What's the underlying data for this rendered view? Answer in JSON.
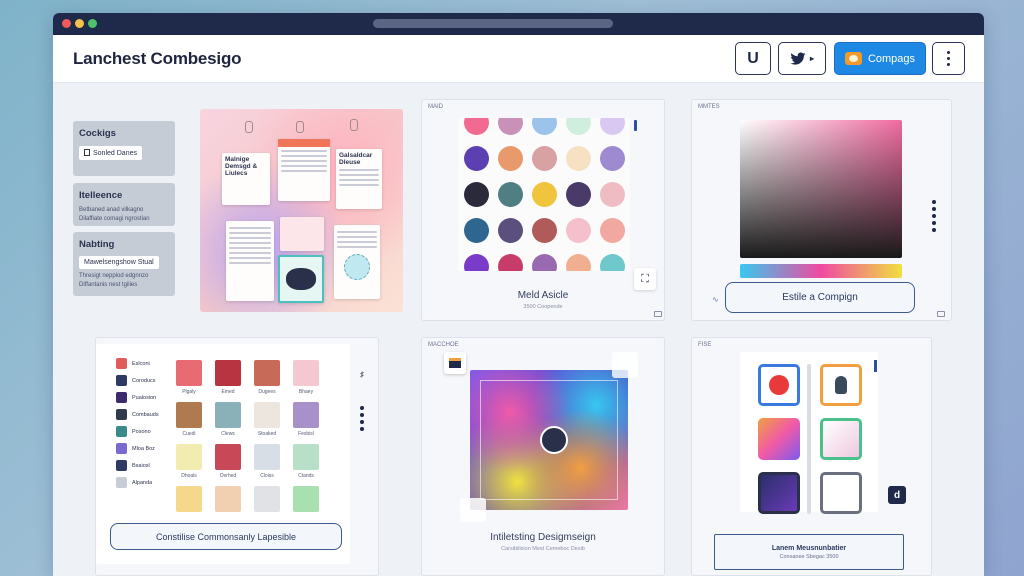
{
  "app": {
    "title": "Lanchest Combesigo"
  },
  "header": {
    "u_button": "U",
    "twitter_icon": "twitter-bird-icon",
    "campaign_button": "Compags",
    "menu_icon": "kebab-menu-icon"
  },
  "sidebar": [
    {
      "title": "Cockigs",
      "pill": "Sonled Danes"
    },
    {
      "title": "Itelleence",
      "lines": [
        "Betbaned anad vilkagno",
        "Dilaffiate comagi ngrostian"
      ]
    },
    {
      "title": "Nabting",
      "pill": "Mawelsengshow Stual",
      "lines": [
        "Thresigt neppiod edgnnzo",
        "Diffantanis nest tgilies"
      ]
    }
  ],
  "collage": {
    "notes": [
      "Malnige Demsgd & Liulecs",
      "Galsaldcar Dleuse"
    ]
  },
  "palette_panel": {
    "tag": "MAID",
    "caption": "Meld Asicle",
    "subcaption": "3500 Coopende",
    "colors": [
      [
        "#f06a92",
        "#c990b8",
        "#9cc4ea",
        "#cfeede",
        "#d8c8f2"
      ],
      [
        "#5c3fb0",
        "#e89a6c",
        "#d9a2a2",
        "#f6e2c2",
        "#9e8ad0"
      ],
      [
        "#2a2a3a",
        "#4f7f82",
        "#f0c43c",
        "#4a3a6a",
        "#f0bcc4"
      ],
      [
        "#2e6690",
        "#5b4f7e",
        "#b05a5a",
        "#f3c0cc",
        "#f0a8a0"
      ],
      [
        "#7a3cc8",
        "#c83c6a",
        "#9a6ab0",
        "#f0b090",
        "#6ec8cc"
      ]
    ]
  },
  "gradient_panel": {
    "tag": "MMTES",
    "button": "Estile a Compign"
  },
  "materials_panel": {
    "rows": [
      {
        "label": "Eslconi",
        "icon_color": "#e25b5b"
      },
      {
        "label": "Coroducs",
        "icon_color": "#2f3a64"
      },
      {
        "label": "Pualosion",
        "icon_color": "#3b2b6a"
      },
      {
        "label": "Combauds",
        "icon_color": "#2f3a4a"
      },
      {
        "label": "Posono",
        "icon_color": "#3a8a8a"
      },
      {
        "label": "Mloa Boz",
        "icon_color": "#7a6ad0"
      },
      {
        "label": "Bsaiosl",
        "icon_color": "#2f3a64"
      },
      {
        "label": "Alpanda",
        "icon_color": "#c8ccd6"
      }
    ],
    "tiles": [
      [
        {
          "c": "#e86a72",
          "l": "Plgaly"
        },
        {
          "c": "#b83440",
          "l": "Emed"
        },
        {
          "c": "#c86a58",
          "l": "Dugees"
        },
        {
          "c": "#f3c8d0",
          "l": "Bhaey"
        }
      ],
      [
        {
          "c": "#b07a50",
          "l": "Cuedi"
        },
        {
          "c": "#8ab0b8",
          "l": "Clews"
        },
        {
          "c": "#ece6de",
          "l": "Stoaked"
        },
        {
          "c": "#a890c8",
          "l": "Fesbisl"
        }
      ],
      [
        {
          "c": "#f3ecb0",
          "l": "Dhoals"
        },
        {
          "c": "#c84858",
          "l": "Osrhed"
        },
        {
          "c": "#d8dee6",
          "l": "Cloiss"
        },
        {
          "c": "#b8e0c8",
          "l": "Ctands"
        }
      ],
      [
        {
          "c": "#f6d88c",
          "l": ""
        },
        {
          "c": "#f0d0b0",
          "l": ""
        },
        {
          "c": "#e0e2e6",
          "l": ""
        },
        {
          "c": "#a8e0b0",
          "l": ""
        }
      ]
    ],
    "button": "Constilise Commonsanly Lapesible"
  },
  "design_panel": {
    "tag": "MACCHOE",
    "caption": "Intiletsting Desigmseign",
    "subcaption": "Carsibilision Mest Cemeboc Desib"
  },
  "device_panel": {
    "tag": "FISE",
    "footer_title": "Lanem Meusnunbatier",
    "footer_sub": "Consanee Sbegac 3500"
  }
}
